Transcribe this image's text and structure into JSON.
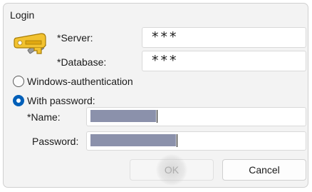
{
  "dialog": {
    "title": "Login",
    "server": {
      "label": "*Server:",
      "value": "***"
    },
    "database": {
      "label": "*Database:",
      "value": "***"
    },
    "auth": {
      "windows_label": "Windows-authentication",
      "password_label": "With password:",
      "selected": "password"
    },
    "name": {
      "label": "*Name:"
    },
    "password": {
      "label": "Password:"
    },
    "buttons": {
      "ok": "OK",
      "cancel": "Cancel"
    }
  },
  "icons": {
    "key": "key-icon"
  },
  "colors": {
    "radio_accent": "#005fb8",
    "redaction": "#8b91ab"
  }
}
